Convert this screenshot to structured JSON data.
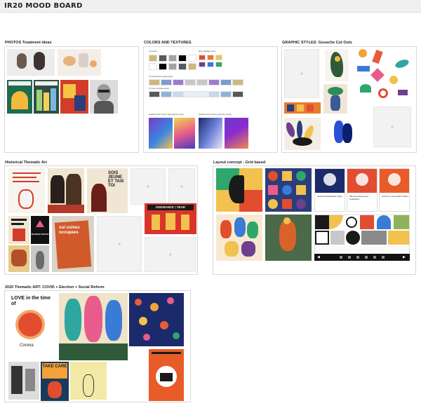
{
  "board": {
    "title": "IR20 MOOD BOARD"
  },
  "sections": {
    "photos": {
      "label": "PHOTOS Treatment ideas"
    },
    "colors": {
      "label": "COLORS AND TEXTURES",
      "sub_labels": [
        "CU Colors",
        "IECU highlight colors",
        "CU Gold Split Complementary",
        "CU Gray Complementary"
      ],
      "texture_captions": [
        "Gradient linear Texture with graphic overlay",
        "Gradient linear Texture with color overlay"
      ],
      "cu_colors": [
        "#cfb87c",
        "#565a5c",
        "#a2a4a3",
        "#000000",
        "#ffffff"
      ],
      "highlight_colors": [
        "#e24d30",
        "#e87a2c",
        "#f2c14e",
        "#6c3f8f",
        "#3a7bd5",
        "#2fa66a"
      ],
      "gold_split": [
        "#cfb87c",
        "#7c9ccf",
        "#9c7ccf",
        "#c8c8c8"
      ],
      "gray_comp": [
        "#565a5c",
        "#8fb3d9",
        "#c9d9ec",
        "#e6eef7"
      ]
    },
    "graphic": {
      "label": "GRAPHIC STYLES: Gouache Cut Outs"
    },
    "historical": {
      "label": "Historical Thematic Art",
      "poster_words": [
        "SOIS JEUNE ET TAIS TOI",
        "IGNORANCE = FEAR",
        "SILENCE=DEATH",
        "oui usines occupees"
      ]
    },
    "layout": {
      "label": "Layout concept : Grid based",
      "card_titles": [
        "Global Sustainability Policy",
        "Planning Agreement Guidelines",
        "Access to Information Policy"
      ]
    },
    "thematic2020": {
      "label": "2020 Thematic ART: COVID + Election + Social Reform",
      "poster_words": [
        "LOVE in the time of",
        "Corona",
        "TAKE CARE"
      ]
    }
  }
}
